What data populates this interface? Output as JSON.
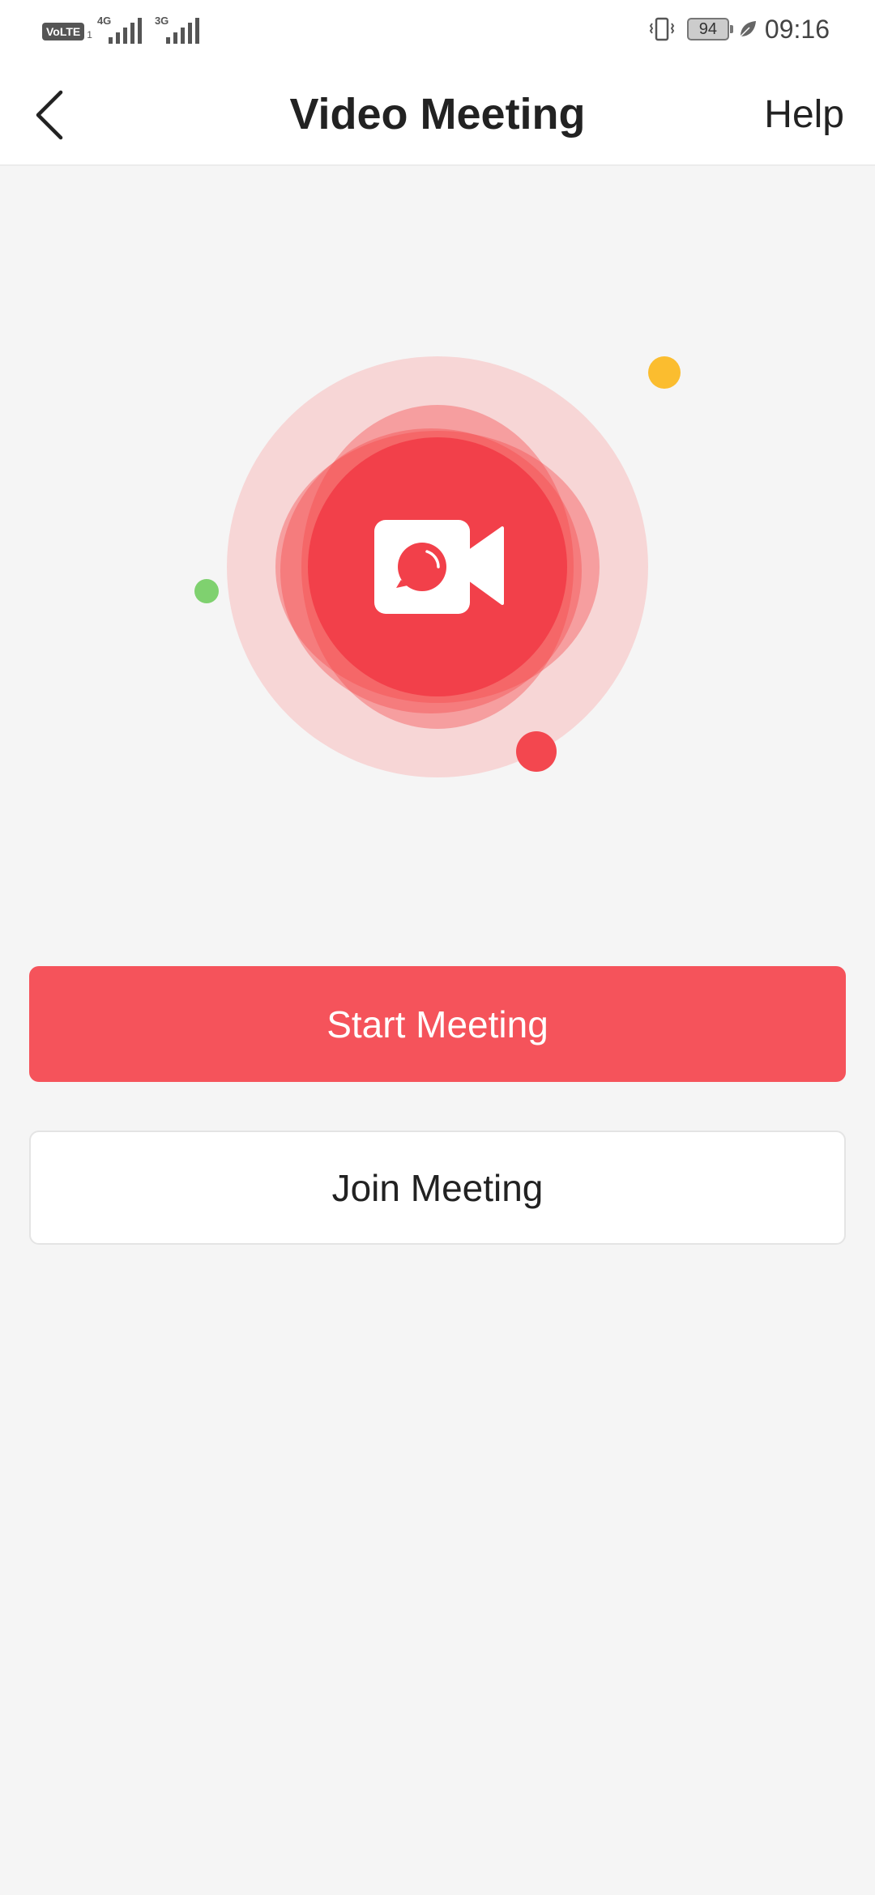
{
  "status_bar": {
    "volte_label": "VoLTE",
    "sim_number": "1",
    "network_1": "4G",
    "network_2": "3G",
    "battery_level": "94",
    "time": "09:16"
  },
  "header": {
    "title": "Video Meeting",
    "help_label": "Help",
    "back_icon": "chevron-left-icon"
  },
  "illustration": {
    "center_icon": "video-camera-icon",
    "colors": {
      "primary": "#f44448",
      "halo": "#f7d6d6",
      "yellow_dot": "#fbbd2f",
      "green_dot": "#7fd16f",
      "red_dot": "#f3474f"
    }
  },
  "actions": {
    "start_label": "Start Meeting",
    "join_label": "Join Meeting"
  }
}
